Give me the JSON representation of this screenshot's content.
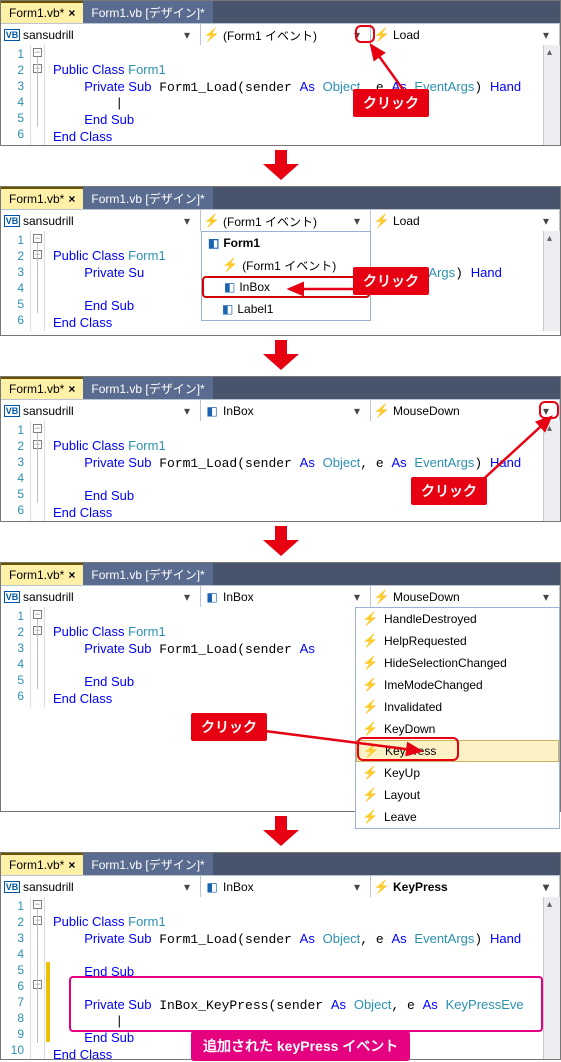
{
  "tabs": {
    "active": "Form1.vb*",
    "design": "Form1.vb [デザイン]*"
  },
  "click": "クリック",
  "added_event": "追加された  keyPress  イベント",
  "p1": {
    "dd": [
      {
        "icon": "vb",
        "text": "sansudrill"
      },
      {
        "icon": "bolt",
        "text": "(Form1 イベント)"
      },
      {
        "icon": "bolt",
        "text": "Load"
      }
    ],
    "lines": [
      "1",
      "2",
      "3",
      "4",
      "5",
      "6"
    ],
    "code": [
      {
        "t": "Public Class ",
        "c": "kw",
        "sfx": "Form1",
        "sfxc": "cls"
      },
      {
        "ind": "    ",
        "t": "Private Sub ",
        "c": "kw",
        "sfx": "Form1_Load(sender ",
        "kw2": "As",
        "mid": " Object",
        "kw3": ", e ",
        "kw4": "As",
        "mid2": " EventArgs",
        "kw5": ") ",
        "kw6": "Hand"
      },
      {
        "ind": "        ",
        "t": "|"
      },
      {
        "ind": "    ",
        "t": "End Sub",
        "c": "kw"
      },
      {
        "t": "End Class",
        "c": "kw"
      },
      {
        "t": ""
      }
    ]
  },
  "p2": {
    "dd": [
      {
        "icon": "vb",
        "text": "sansudrill"
      },
      {
        "icon": "bolt",
        "text": "(Form1 イベント)"
      },
      {
        "icon": "bolt",
        "text": "Load"
      }
    ],
    "menu": [
      {
        "icon": "comp",
        "text": "Form1",
        "header": true
      },
      {
        "icon": "bolt",
        "text": "(Form1 イベント)",
        "ind": true
      },
      {
        "icon": "comp",
        "text": "InBox",
        "ind": true,
        "sel": true
      },
      {
        "icon": "comp",
        "text": "Label1",
        "ind": true
      }
    ],
    "lines": [
      "1",
      "2",
      "3",
      "4",
      "5",
      "6"
    ]
  },
  "p3": {
    "dd": [
      {
        "icon": "vb",
        "text": "sansudrill"
      },
      {
        "icon": "comp",
        "text": "InBox"
      },
      {
        "icon": "bolt",
        "text": "MouseDown"
      }
    ],
    "lines": [
      "1",
      "2",
      "3",
      "4",
      "5",
      "6"
    ]
  },
  "p4": {
    "dd": [
      {
        "icon": "vb",
        "text": "sansudrill"
      },
      {
        "icon": "comp",
        "text": "InBox"
      },
      {
        "icon": "bolt",
        "text": "MouseDown"
      }
    ],
    "events": [
      "HandleDestroyed",
      "HelpRequested",
      "HideSelectionChanged",
      "ImeModeChanged",
      "Invalidated",
      "KeyDown",
      "KeyPress",
      "KeyUp",
      "Layout",
      "Leave"
    ],
    "lines": [
      "1",
      "2",
      "3",
      "4",
      "5",
      "6"
    ]
  },
  "p5": {
    "dd": [
      {
        "icon": "vb",
        "text": "sansudrill"
      },
      {
        "icon": "comp",
        "text": "InBox"
      },
      {
        "icon": "bolt",
        "text": "KeyPress",
        "bold": true
      }
    ],
    "lines": [
      "1",
      "2",
      "3",
      "4",
      "5",
      "6",
      "7",
      "8",
      "9",
      "10"
    ]
  }
}
